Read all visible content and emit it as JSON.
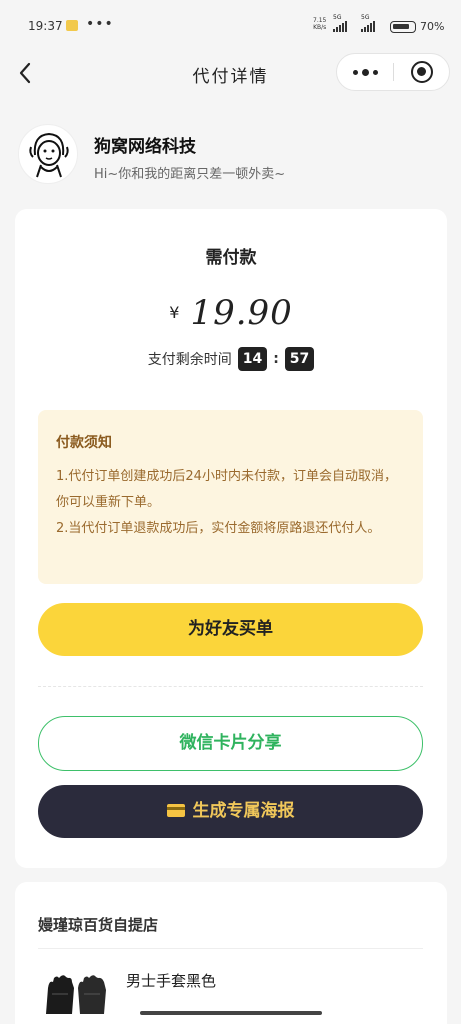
{
  "status_bar": {
    "time": "19:37",
    "more_dots": "•••",
    "net_speed_value": "7.15",
    "net_speed_unit": "KB/s",
    "signal1_label": "5G",
    "signal2_label": "5G",
    "battery_percent": "70%"
  },
  "nav": {
    "title": "代付详情",
    "back_icon": "chevron-left-icon",
    "more_icon": "more-dots-icon",
    "close_icon": "target-close-icon"
  },
  "shop": {
    "name": "狗窝网络科技",
    "slogan": "Hi~你和我的距离只差一顿外卖~"
  },
  "payment": {
    "due_label": "需付款",
    "currency": "¥",
    "amount": "19.90",
    "countdown_label": "支付剩余时间",
    "countdown_minutes": "14",
    "countdown_sep": ":",
    "countdown_seconds": "57"
  },
  "notice": {
    "title": "付款须知",
    "items": [
      "1.代付订单创建成功后24小时内未付款，订单会自动取消，你可以重新下单。",
      "2.当代付订单退款成功后，实付金额将原路退还代付人。"
    ]
  },
  "actions": {
    "buy_label": "为好友买单",
    "share_label": "微信卡片分享",
    "poster_label": "生成专属海报",
    "poster_icon": "card-icon"
  },
  "order": {
    "store_name": "嫚瑾琼百货自提店",
    "product_name": "男士手套黑色",
    "product_image": "black-gloves"
  },
  "colors": {
    "accent_yellow": "#fbd53a",
    "share_green": "#2fb35e",
    "poster_dark": "#2b2b3c",
    "notice_bg": "#fdf5e0"
  }
}
